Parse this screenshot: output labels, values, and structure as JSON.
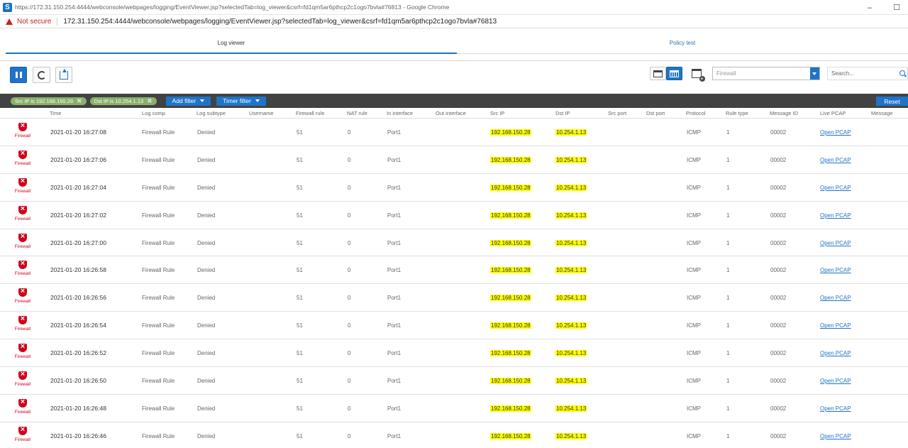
{
  "browser": {
    "title": "https://172.31.150.254:4444/webconsole/webpages/logging/EventViewer.jsp?selectedTab=log_viewer&csrf=fd1qm5ar6pthcp2c1ogo7bvla#76813 - Google Chrome",
    "security_label": "Not secure",
    "url": "172.31.150.254:4444/webconsole/webpages/logging/EventViewer.jsp?selectedTab=log_viewer&csrf=fd1qm5ar6pthcp2c1ogo7bvla#76813",
    "minimize": "–",
    "maximize": "☐"
  },
  "tabs": [
    {
      "label": "Log viewer",
      "active": true
    },
    {
      "label": "Policy test",
      "active": false
    }
  ],
  "toolbar": {
    "module_select": "Firewall",
    "search_placeholder": "Search..."
  },
  "filters": {
    "chips": [
      "Src IP is 192.168.150.28",
      "Dst IP is 10.254.1.13"
    ],
    "chip_remove": "✖",
    "add_filter": "Add filter",
    "timer_filter": "Timer filter",
    "reset": "Reset"
  },
  "columns": [
    "Time",
    "Log comp",
    "Log subtype",
    "Username",
    "Firewall rule",
    "NAT rule",
    "In interface",
    "Out interface",
    "Src IP",
    "Dst IP",
    "Src port",
    "Dst port",
    "Protocol",
    "Rule type",
    "Message ID",
    "Live PCAP",
    "Message"
  ],
  "rows": [
    {
      "module": "Firewall",
      "time": "2021-01-20 16:27:08",
      "log_comp": "Firewall Rule",
      "log_subtype": "Denied",
      "fw_rule": "51",
      "nat_rule": "0",
      "in_if": "Port1",
      "src_ip": "192.168.150.28",
      "dst_ip": "10.254.1.13",
      "protocol": "ICMP",
      "rule_type": "1",
      "msg_id": "00002",
      "pcap": "Open PCAP"
    },
    {
      "module": "Firewall",
      "time": "2021-01-20 16:27:06",
      "log_comp": "Firewall Rule",
      "log_subtype": "Denied",
      "fw_rule": "51",
      "nat_rule": "0",
      "in_if": "Port1",
      "src_ip": "192.168.150.28",
      "dst_ip": "10.254.1.13",
      "protocol": "ICMP",
      "rule_type": "1",
      "msg_id": "00002",
      "pcap": "Open PCAP"
    },
    {
      "module": "Firewall",
      "time": "2021-01-20 16:27:04",
      "log_comp": "Firewall Rule",
      "log_subtype": "Denied",
      "fw_rule": "51",
      "nat_rule": "0",
      "in_if": "Port1",
      "src_ip": "192.168.150.28",
      "dst_ip": "10.254.1.13",
      "protocol": "ICMP",
      "rule_type": "1",
      "msg_id": "00002",
      "pcap": "Open PCAP"
    },
    {
      "module": "Firewall",
      "time": "2021-01-20 16:27:02",
      "log_comp": "Firewall Rule",
      "log_subtype": "Denied",
      "fw_rule": "51",
      "nat_rule": "0",
      "in_if": "Port1",
      "src_ip": "192.168.150.28",
      "dst_ip": "10.254.1.13",
      "protocol": "ICMP",
      "rule_type": "1",
      "msg_id": "00002",
      "pcap": "Open PCAP"
    },
    {
      "module": "Firewall",
      "time": "2021-01-20 16:27:00",
      "log_comp": "Firewall Rule",
      "log_subtype": "Denied",
      "fw_rule": "51",
      "nat_rule": "0",
      "in_if": "Port1",
      "src_ip": "192.168.150.28",
      "dst_ip": "10.254.1.13",
      "protocol": "ICMP",
      "rule_type": "1",
      "msg_id": "00002",
      "pcap": "Open PCAP"
    },
    {
      "module": "Firewall",
      "time": "2021-01-20 16:26:58",
      "log_comp": "Firewall Rule",
      "log_subtype": "Denied",
      "fw_rule": "51",
      "nat_rule": "0",
      "in_if": "Port1",
      "src_ip": "192.168.150.28",
      "dst_ip": "10.254.1.13",
      "protocol": "ICMP",
      "rule_type": "1",
      "msg_id": "00002",
      "pcap": "Open PCAP"
    },
    {
      "module": "Firewall",
      "time": "2021-01-20 16:26:56",
      "log_comp": "Firewall Rule",
      "log_subtype": "Denied",
      "fw_rule": "51",
      "nat_rule": "0",
      "in_if": "Port1",
      "src_ip": "192.168.150.28",
      "dst_ip": "10.254.1.13",
      "protocol": "ICMP",
      "rule_type": "1",
      "msg_id": "00002",
      "pcap": "Open PCAP"
    },
    {
      "module": "Firewall",
      "time": "2021-01-20 16:26:54",
      "log_comp": "Firewall Rule",
      "log_subtype": "Denied",
      "fw_rule": "51",
      "nat_rule": "0",
      "in_if": "Port1",
      "src_ip": "192.168.150.28",
      "dst_ip": "10.254.1.13",
      "protocol": "ICMP",
      "rule_type": "1",
      "msg_id": "00002",
      "pcap": "Open PCAP"
    },
    {
      "module": "Firewall",
      "time": "2021-01-20 16:26:52",
      "log_comp": "Firewall Rule",
      "log_subtype": "Denied",
      "fw_rule": "51",
      "nat_rule": "0",
      "in_if": "Port1",
      "src_ip": "192.168.150.28",
      "dst_ip": "10.254.1.13",
      "protocol": "ICMP",
      "rule_type": "1",
      "msg_id": "00002",
      "pcap": "Open PCAP"
    },
    {
      "module": "Firewall",
      "time": "2021-01-20 16:26:50",
      "log_comp": "Firewall Rule",
      "log_subtype": "Denied",
      "fw_rule": "51",
      "nat_rule": "0",
      "in_if": "Port1",
      "src_ip": "192.168.150.28",
      "dst_ip": "10.254.1.13",
      "protocol": "ICMP",
      "rule_type": "1",
      "msg_id": "00002",
      "pcap": "Open PCAP"
    },
    {
      "module": "Firewall",
      "time": "2021-01-20 16:26:48",
      "log_comp": "Firewall Rule",
      "log_subtype": "Denied",
      "fw_rule": "51",
      "nat_rule": "0",
      "in_if": "Port1",
      "src_ip": "192.168.150.28",
      "dst_ip": "10.254.1.13",
      "protocol": "ICMP",
      "rule_type": "1",
      "msg_id": "00002",
      "pcap": "Open PCAP"
    },
    {
      "module": "Firewall",
      "time": "2021-01-20 16:26:46",
      "log_comp": "Firewall Rule",
      "log_subtype": "Denied",
      "fw_rule": "51",
      "nat_rule": "0",
      "in_if": "Port1",
      "src_ip": "192.168.150.28",
      "dst_ip": "10.254.1.13",
      "protocol": "ICMP",
      "rule_type": "1",
      "msg_id": "00002",
      "pcap": "Open PCAP"
    }
  ]
}
